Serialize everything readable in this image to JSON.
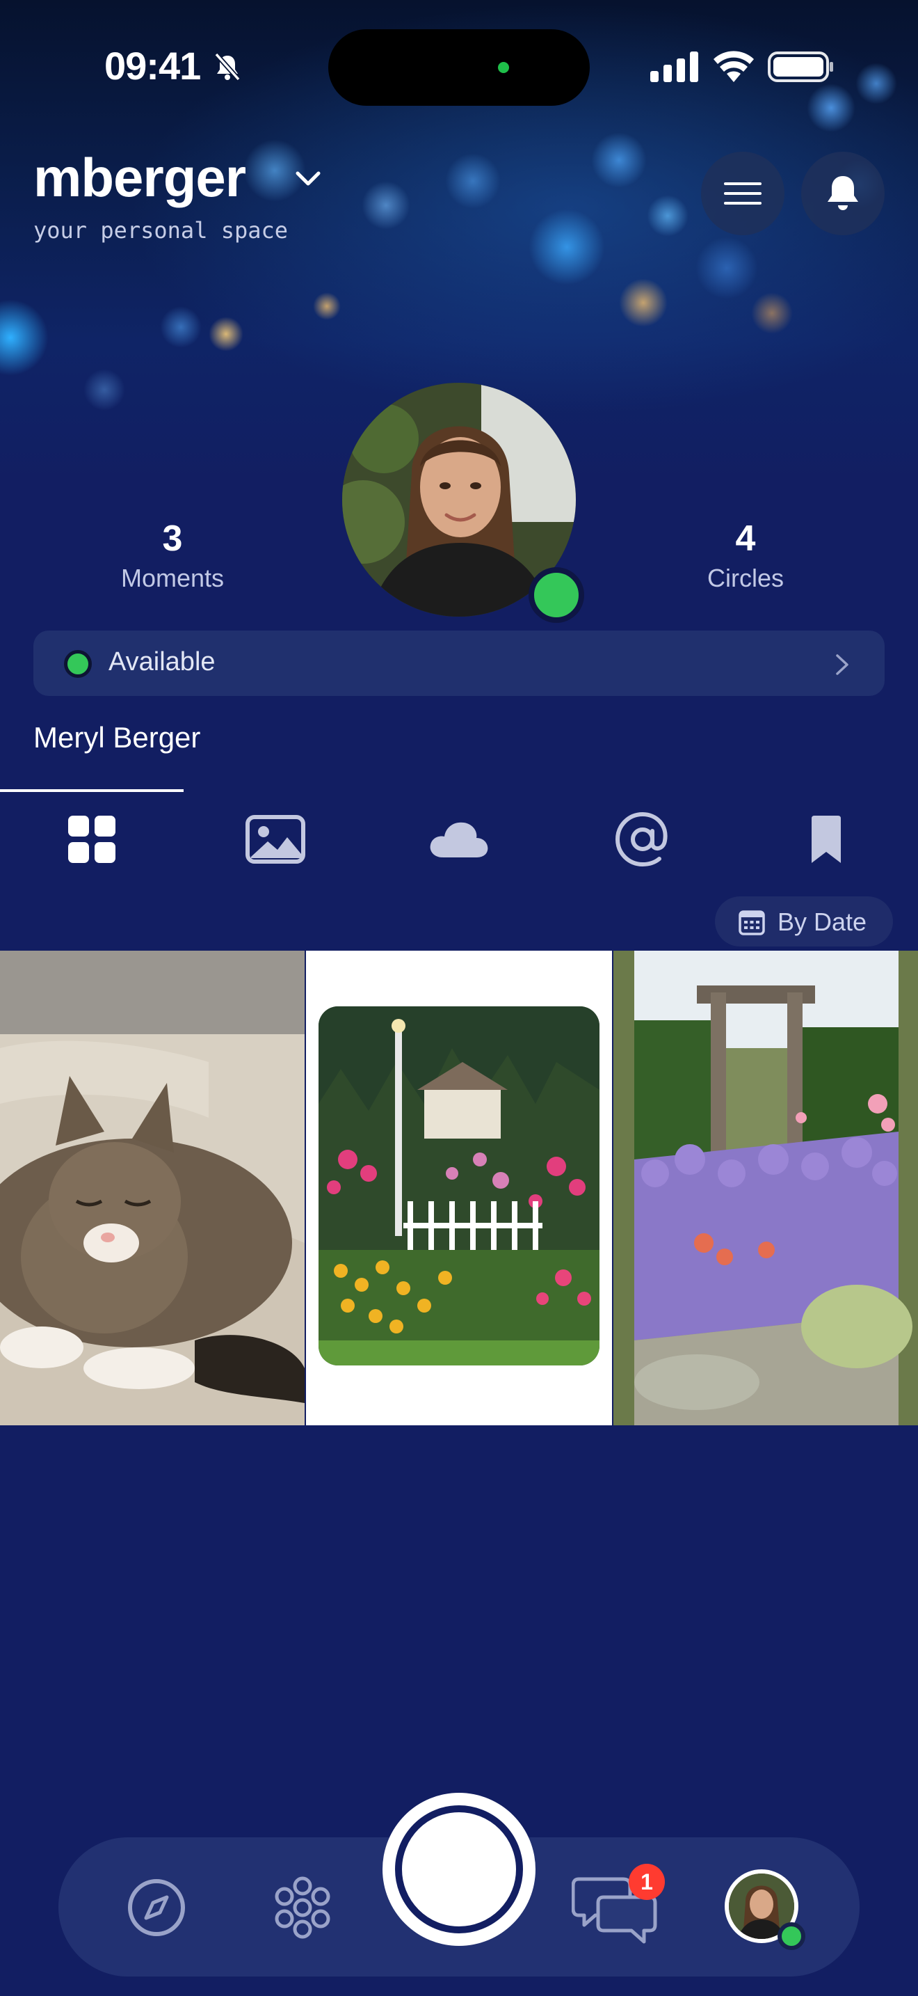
{
  "status_bar": {
    "time": "09:41"
  },
  "header": {
    "username": "mberger",
    "subtitle": "your personal space"
  },
  "stats": {
    "moments_count": "3",
    "moments_label": "Moments",
    "circles_count": "4",
    "circles_label": "Circles"
  },
  "profile": {
    "status_label": "Available",
    "status_color": "#34c759",
    "display_name": "Meryl Berger"
  },
  "tabs": [
    {
      "icon": "grid-icon",
      "active": true
    },
    {
      "icon": "image-icon",
      "active": false
    },
    {
      "icon": "cloud-icon",
      "active": false
    },
    {
      "icon": "at-icon",
      "active": false
    },
    {
      "icon": "bookmark-icon",
      "active": false
    }
  ],
  "sort": {
    "label": "By Date",
    "icon": "calendar-icon"
  },
  "grid": [
    {
      "subject": "sleeping-cat"
    },
    {
      "subject": "cottage-garden"
    },
    {
      "subject": "lavender-garden"
    }
  ],
  "bottom_nav": {
    "items": [
      "compass-icon",
      "circles-icon",
      "capture-button",
      "chat-icon",
      "profile-avatar"
    ],
    "chat_badge": "1"
  },
  "colors": {
    "background": "#121e62",
    "accent_green": "#34c759",
    "badge_red": "#ff3b30"
  }
}
